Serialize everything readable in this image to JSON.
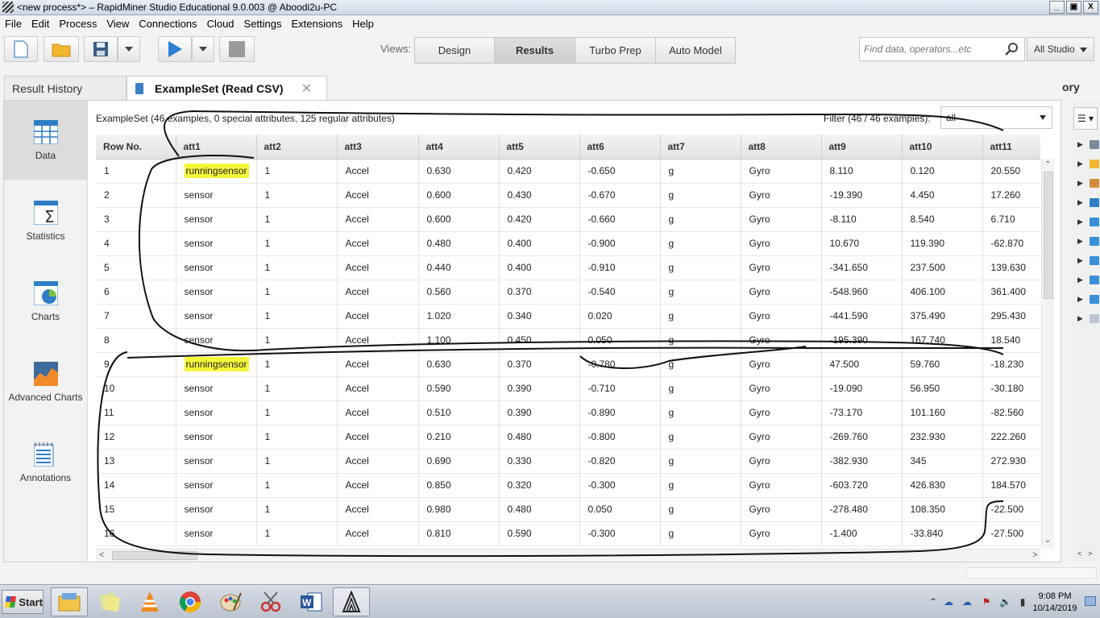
{
  "window": {
    "title": "<new process*> – RapidMiner Studio Educational 9.0.003 @ Aboodi2u-PC",
    "min": "_",
    "max": "▣",
    "close": "X"
  },
  "menu": [
    "File",
    "Edit",
    "Process",
    "View",
    "Connections",
    "Cloud",
    "Settings",
    "Extensions",
    "Help"
  ],
  "toolbar": {
    "views_label": "Views:",
    "views": [
      "Design",
      "Results",
      "Turbo Prep",
      "Auto Model"
    ],
    "active_view": "Results",
    "search_placeholder": "Find data, operators...etc",
    "studio_select": "All Studio"
  },
  "tabs": {
    "history": "Result History",
    "example": "ExampleSet (Read CSV)",
    "close": "✕",
    "right_partial": "ory"
  },
  "leftnav": [
    "Data",
    "Statistics",
    "Charts",
    "Advanced Charts",
    "Annotations"
  ],
  "exampleset_info": "ExampleSet (46 examples, 0 special attributes, 125 regular attributes)",
  "filter": {
    "label": "Filter (46 / 46 examples):",
    "value": "all"
  },
  "table": {
    "headers": [
      "Row No.",
      "att1",
      "att2",
      "att3",
      "att4",
      "att5",
      "att6",
      "att7",
      "att8",
      "att9",
      "att10",
      "att11"
    ],
    "rows": [
      [
        "1",
        "runningsensor",
        "1",
        "Accel",
        "0.630",
        "0.420",
        "-0.650",
        "g",
        "Gyro",
        "8.110",
        "0.120",
        "20.550"
      ],
      [
        "2",
        "sensor",
        "1",
        "Accel",
        "0.600",
        "0.430",
        "-0.670",
        "g",
        "Gyro",
        "-19.390",
        "4.450",
        "17.260"
      ],
      [
        "3",
        "sensor",
        "1",
        "Accel",
        "0.600",
        "0.420",
        "-0.660",
        "g",
        "Gyro",
        "-8.110",
        "8.540",
        "6.710"
      ],
      [
        "4",
        "sensor",
        "1",
        "Accel",
        "0.480",
        "0.400",
        "-0.900",
        "g",
        "Gyro",
        "10.670",
        "119.390",
        "-62.870"
      ],
      [
        "5",
        "sensor",
        "1",
        "Accel",
        "0.440",
        "0.400",
        "-0.910",
        "g",
        "Gyro",
        "-341.650",
        "237.500",
        "139.630"
      ],
      [
        "6",
        "sensor",
        "1",
        "Accel",
        "0.560",
        "0.370",
        "-0.540",
        "g",
        "Gyro",
        "-548.960",
        "406.100",
        "361.400"
      ],
      [
        "7",
        "sensor",
        "1",
        "Accel",
        "1.020",
        "0.340",
        "0.020",
        "g",
        "Gyro",
        "-441.590",
        "375.490",
        "295.430"
      ],
      [
        "8",
        "sensor",
        "1",
        "Accel",
        "1.100",
        "0.450",
        "0.050",
        "g",
        "Gyro",
        "-195.390",
        "167.740",
        "18.540"
      ],
      [
        "9",
        "runningsensor",
        "1",
        "Accel",
        "0.630",
        "0.370",
        "-0.780",
        "g",
        "Gyro",
        "47.500",
        "59.760",
        "-18.230"
      ],
      [
        "10",
        "sensor",
        "1",
        "Accel",
        "0.590",
        "0.390",
        "-0.710",
        "g",
        "Gyro",
        "-19.090",
        "56.950",
        "-30.180"
      ],
      [
        "11",
        "sensor",
        "1",
        "Accel",
        "0.510",
        "0.390",
        "-0.890",
        "g",
        "Gyro",
        "-73.170",
        "101.160",
        "-82.560"
      ],
      [
        "12",
        "sensor",
        "1",
        "Accel",
        "0.210",
        "0.480",
        "-0.800",
        "g",
        "Gyro",
        "-269.760",
        "232.930",
        "222.260"
      ],
      [
        "13",
        "sensor",
        "1",
        "Accel",
        "0.690",
        "0.330",
        "-0.820",
        "g",
        "Gyro",
        "-382.930",
        "345",
        "272.930"
      ],
      [
        "14",
        "sensor",
        "1",
        "Accel",
        "0.850",
        "0.320",
        "-0.300",
        "g",
        "Gyro",
        "-603.720",
        "426.830",
        "184.570"
      ],
      [
        "15",
        "sensor",
        "1",
        "Accel",
        "0.980",
        "0.480",
        "0.050",
        "g",
        "Gyro",
        "-278.480",
        "108.350",
        "-22.500"
      ],
      [
        "16",
        "sensor",
        "1",
        "Accel",
        "0.810",
        "0.590",
        "-0.300",
        "g",
        "Gyro",
        "-1.400",
        "-33.840",
        "-27.500"
      ]
    ],
    "highlighted_rows": [
      0,
      8
    ],
    "highlight_color": "#f5f53a"
  },
  "taskbar": {
    "start": "Start",
    "time": "9:08 PM",
    "date": "10/14/2019",
    "apps": [
      "file-explorer-icon",
      "sticky-notes-icon",
      "vlc-icon",
      "chrome-icon",
      "paint-icon",
      "snipping-tool-icon",
      "word-icon",
      "rapidminer-icon"
    ]
  },
  "colors": {
    "accent": "#1e73be",
    "annotation_ink": "#111111"
  }
}
